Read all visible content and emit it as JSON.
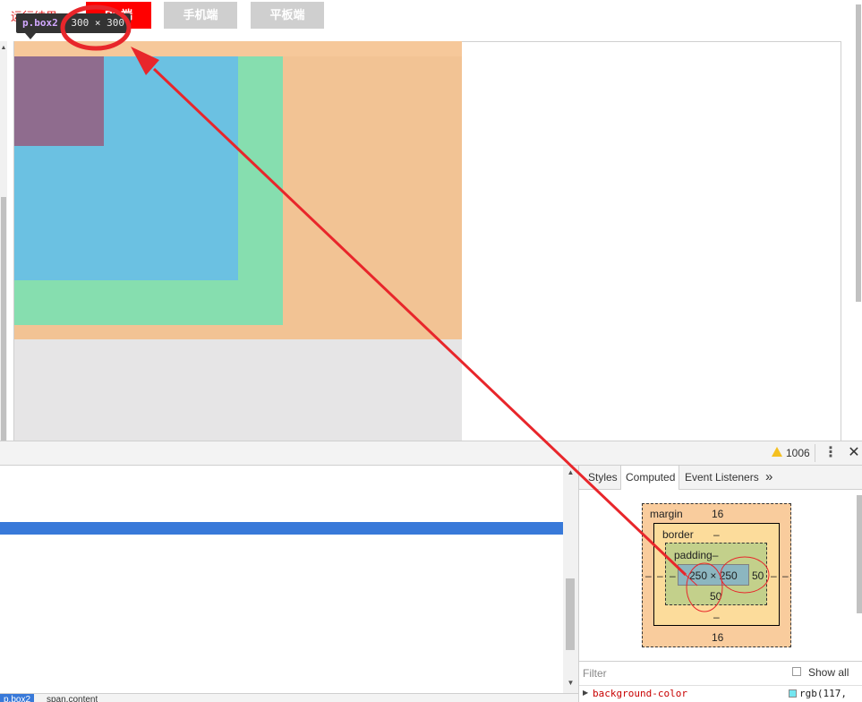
{
  "toolbar": {
    "run_label": "运行结果",
    "tabs": [
      "PC端",
      "手机端",
      "平板端"
    ],
    "active_color": "#ff0000",
    "inactive_color": "#cfcfcf"
  },
  "preview": {
    "colors": {
      "margin": "#f6c89a",
      "border_area": "#f2c394",
      "padding": "#86deaf",
      "content": "#6bc1e2",
      "box1": "#8f6c8e",
      "body": "#e6e5e6"
    }
  },
  "tooltip": {
    "element": "p.box2",
    "size": "300 × 300"
  },
  "devtools": {
    "warning_count": "1006",
    "menu_icon": "kebab-icon",
    "close_icon": "close-icon",
    "breadcrumb": [
      "p.box2",
      "span.content"
    ],
    "sidebar_tabs": [
      "Styles",
      "Computed",
      "Event Listeners"
    ],
    "active_sidebar_tab": "Computed",
    "more_tabs_symbol": "»"
  },
  "box_model": {
    "margin_label": "margin",
    "margin_top": "16",
    "margin_bottom": "16",
    "margin_left": "–",
    "margin_right": "–",
    "border_label": "border",
    "border_top": "–",
    "border_bottom": "–",
    "border_left": "–",
    "border_right": "–",
    "padding_label": "padding–",
    "padding_left": "–",
    "padding_right": "50",
    "padding_bottom": "50",
    "content_size": "250 × 250"
  },
  "computed": {
    "filter_placeholder": "Filter",
    "show_all_label": "Show all",
    "show_all_checked": false,
    "properties": [
      {
        "name": "background-color",
        "value": "rgb(117,",
        "swatch": "#75e6f0"
      }
    ]
  },
  "annotation_color": "#e8262b"
}
